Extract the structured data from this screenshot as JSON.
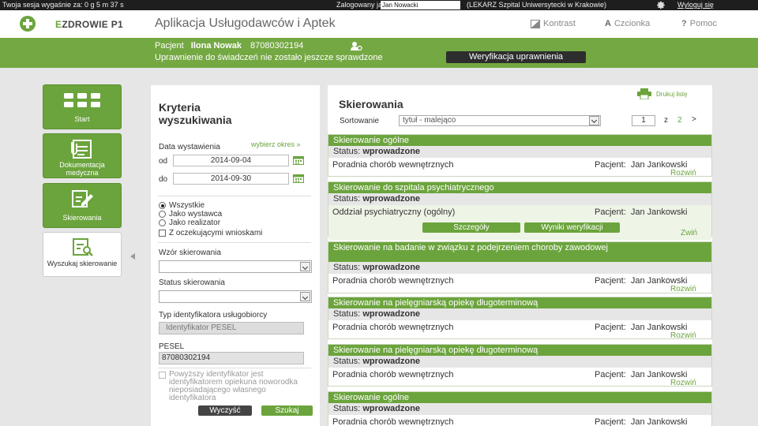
{
  "topbar": {
    "session": "Twoja sesja wygaśnie za: 0 g 5 m 37 s",
    "logged_label": "Zalogowany jako:",
    "username": "Jan Nowacki",
    "org": "(LEKARZ Szpital Uniwersytecki w Krakowie)",
    "logout": "Wyloguj się"
  },
  "header": {
    "brand_e": "E",
    "brand_rest": "ZDROWIE P1",
    "title": "Aplikacja Usługodawców i Aptek",
    "links": [
      "Kontrast",
      "Czcionka",
      "Pomoc"
    ]
  },
  "patient": {
    "label": "Pacjent",
    "name": "Ilona Nowak",
    "pesel": "87080302194",
    "warning": "Uprawnienie do świadczeń nie zostało jeszcze sprawdzone",
    "verify_button": "Weryfikacja uprawnienia"
  },
  "nav": [
    {
      "label": "Start"
    },
    {
      "label": "Dokumentacja medyczna"
    },
    {
      "label": "Skierowania"
    },
    {
      "label": "Wyszukaj skierowanie"
    }
  ],
  "criteria": {
    "title_1": "Kryteria",
    "title_2": "wyszukiwania",
    "date_label": "Data wystawienia",
    "choose_period": "wybierz okres »",
    "from_label": "od",
    "from_value": "2014-09-04",
    "to_label": "do",
    "to_value": "2014-09-30",
    "radio_all": "Wszystkie",
    "radio_issuer": "Jako wystawca",
    "radio_realizer": "Jako realizator",
    "pending_check": "Z oczekującymi wnioskami",
    "template_label": "Wzór skierowania",
    "status_label": "Status skierowania",
    "id_type_label": "Typ identyfikatora usługobiorcy",
    "id_type_value": "Identyfikator PESEL",
    "pesel_label": "PESEL",
    "pesel_value": "87080302194",
    "guardian_note": "Powyższy identyfikator jest identyfikatorem opiekuna noworodka nieposiadającego własnego identyfikatora",
    "clear_button": "Wyczyść",
    "search_button": "Szukaj"
  },
  "results": {
    "title": "Skierowania",
    "print": "Drukuj listę",
    "sort_label": "Sortowanie",
    "sort_value": "tytuł - malejąco",
    "page_current": "1",
    "page_of": "z",
    "page_total": "2",
    "page_next": ">",
    "status_prefix": "Status:",
    "patient_prefix": "Pacjent:",
    "details_button": "Szczegóły",
    "verify_results_button": "Wyniki weryfikacji",
    "expand": "Rozwiń",
    "collapse": "Zwiń",
    "items": [
      {
        "title": "Skierowanie ogólne",
        "status": "wprowadzone",
        "unit": "Poradnia chorób wewnętrznych",
        "patient": "Jan Jankowski"
      },
      {
        "title": "Skierowanie do szpitala psychiatrycznego",
        "status": "wprowadzone",
        "unit": "Oddział psychiatryczny (ogólny)",
        "patient": "Jan Jankowski"
      },
      {
        "title": "Skierowanie na badanie w związku z podejrzeniem choroby zawodowej",
        "status": "wprowadzone",
        "unit": "Poradnia chorób wewnętrznych",
        "patient": "Jan Jankowski"
      },
      {
        "title": "Skierowanie na pielęgniarską opiekę długoterminową",
        "status": "wprowadzone",
        "unit": "Poradnia chorób wewnętrznych",
        "patient": "Jan Jankowski"
      },
      {
        "title": "Skierowanie na pielęgniarską opiekę długoterminową",
        "status": "wprowadzone",
        "unit": "Poradnia chorób wewnętrznych",
        "patient": "Jan Jankowski"
      },
      {
        "title": "Skierowanie ogólne",
        "status": "wprowadzone",
        "unit": "Poradnia chorób wewnętrznych",
        "patient": "Jan Jankowski"
      }
    ]
  }
}
